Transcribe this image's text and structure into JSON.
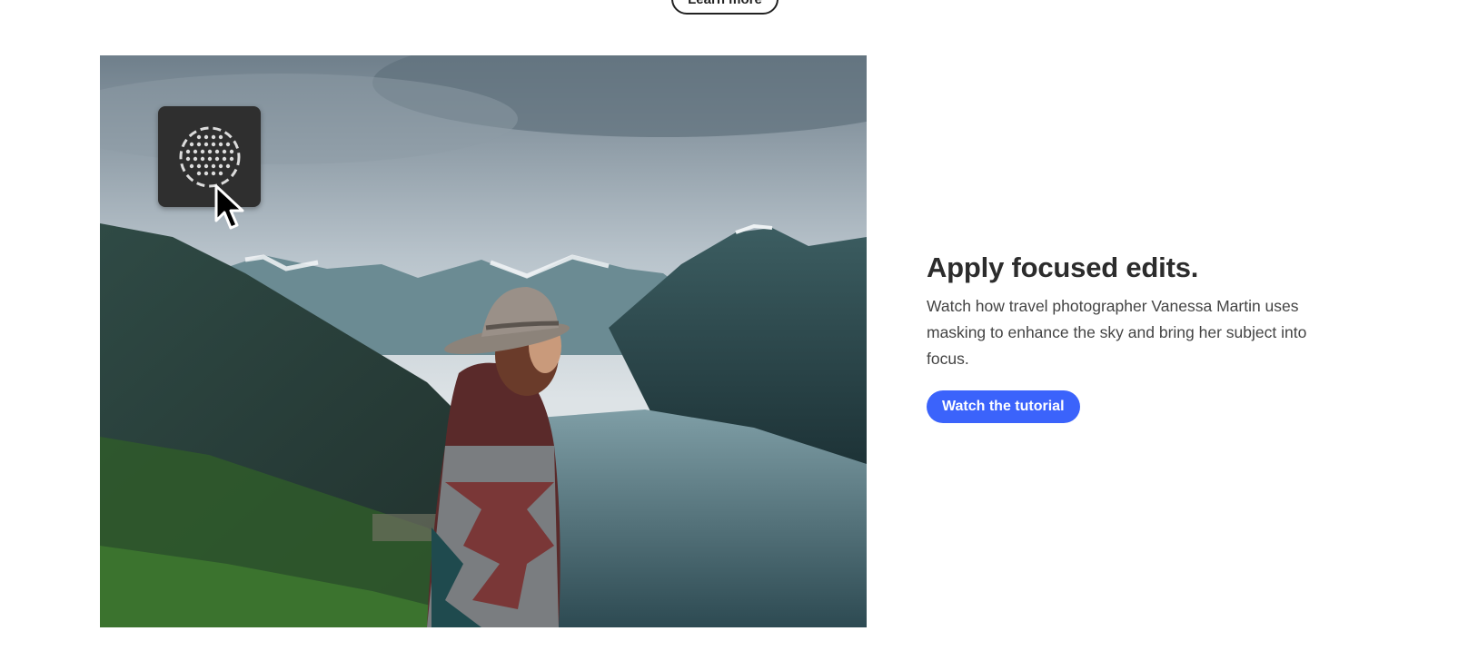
{
  "top": {
    "learn_more_label": "Learn more"
  },
  "hero": {
    "image_subject": "travel photographer in hat overlooking fjord and mountains",
    "tile_icon": "mask-radial-dots-icon",
    "cursor_icon": "mouse-pointer-icon"
  },
  "content": {
    "headline": "Apply focused edits.",
    "body": "Watch how travel photographer Vanessa Martin uses masking to enhance the sky and bring her subject into focus.",
    "cta_label": "Watch the tutorial"
  },
  "colors": {
    "accent": "#3b63fb",
    "text": "#2c2c2c",
    "tile_bg": "#2f2f2f"
  }
}
